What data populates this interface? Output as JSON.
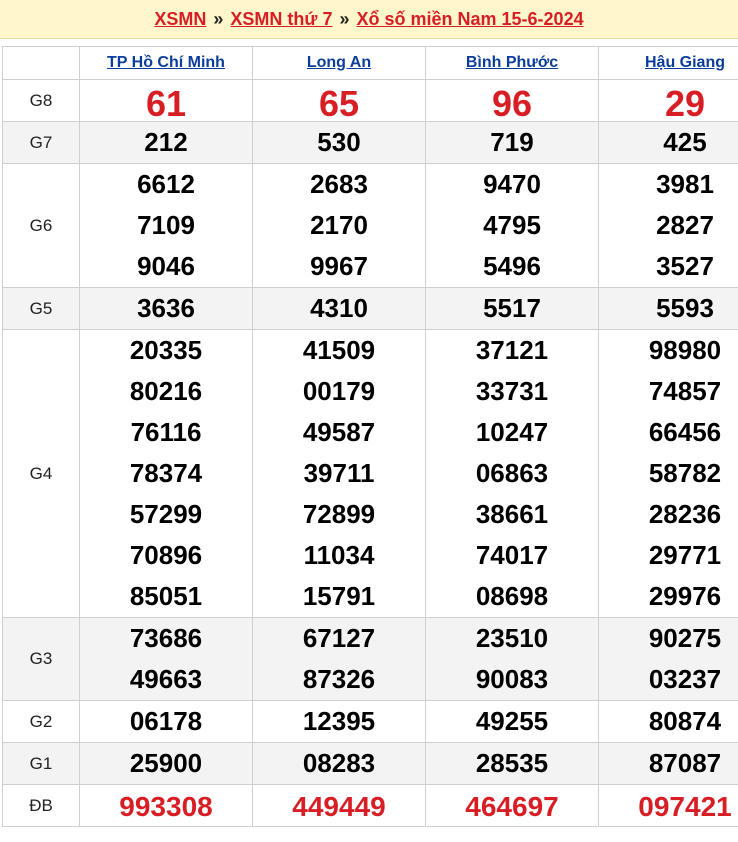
{
  "header": {
    "crumb1": "XSMN",
    "sep": "»",
    "crumb2": "XSMN thứ 7",
    "crumb3": "Xổ số miền Nam 15-6-2024"
  },
  "colors": {
    "red": "#d81e25",
    "link_blue": "#0b3d9a",
    "header_bg": "#fff6cc"
  },
  "provinces": [
    "TP Hồ Chí Minh",
    "Long An",
    "Bình Phước",
    "Hậu Giang"
  ],
  "prizes": [
    {
      "label": "G8",
      "style": "big",
      "values": [
        [
          "61"
        ],
        [
          "65"
        ],
        [
          "96"
        ],
        [
          "29"
        ]
      ]
    },
    {
      "label": "G7",
      "style": "num",
      "values": [
        [
          "212"
        ],
        [
          "530"
        ],
        [
          "719"
        ],
        [
          "425"
        ]
      ]
    },
    {
      "label": "G6",
      "style": "num",
      "values": [
        [
          "6612",
          "7109",
          "9046"
        ],
        [
          "2683",
          "2170",
          "9967"
        ],
        [
          "9470",
          "4795",
          "5496"
        ],
        [
          "3981",
          "2827",
          "3527"
        ]
      ]
    },
    {
      "label": "G5",
      "style": "num",
      "values": [
        [
          "3636"
        ],
        [
          "4310"
        ],
        [
          "5517"
        ],
        [
          "5593"
        ]
      ]
    },
    {
      "label": "G4",
      "style": "num",
      "values": [
        [
          "20335",
          "80216",
          "76116",
          "78374",
          "57299",
          "70896",
          "85051"
        ],
        [
          "41509",
          "00179",
          "49587",
          "39711",
          "72899",
          "11034",
          "15791"
        ],
        [
          "37121",
          "33731",
          "10247",
          "06863",
          "38661",
          "74017",
          "08698"
        ],
        [
          "98980",
          "74857",
          "66456",
          "58782",
          "28236",
          "29771",
          "29976"
        ]
      ]
    },
    {
      "label": "G3",
      "style": "num",
      "values": [
        [
          "73686",
          "49663"
        ],
        [
          "67127",
          "87326"
        ],
        [
          "23510",
          "90083"
        ],
        [
          "90275",
          "03237"
        ]
      ]
    },
    {
      "label": "G2",
      "style": "num",
      "values": [
        [
          "06178"
        ],
        [
          "12395"
        ],
        [
          "49255"
        ],
        [
          "80874"
        ]
      ]
    },
    {
      "label": "G1",
      "style": "num",
      "values": [
        [
          "25900"
        ],
        [
          "08283"
        ],
        [
          "28535"
        ],
        [
          "87087"
        ]
      ]
    },
    {
      "label": "ĐB",
      "style": "db",
      "values": [
        [
          "993308"
        ],
        [
          "449449"
        ],
        [
          "464697"
        ],
        [
          "097421"
        ]
      ]
    }
  ]
}
